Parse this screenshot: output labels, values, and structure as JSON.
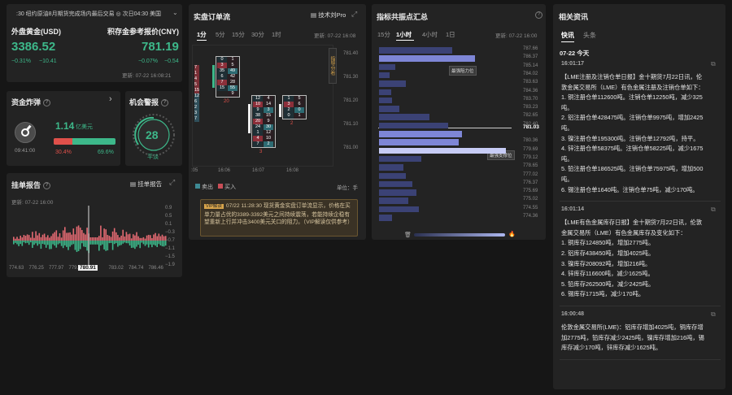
{
  "ticker": {
    "text": ":30 纽约原油8月期货完成场内最后交易 ◎ 次日04:30 美国",
    "arrow": "chevron-down"
  },
  "gold": {
    "left_title": "外盘黄金(USD)",
    "left_price": "3386.52",
    "left_pct": "−0.31%",
    "left_chg": "−10.41",
    "right_title": "积存金参考报价(CNY)",
    "right_price": "781.19",
    "right_pct": "−0.07%",
    "right_chg": "−0.54",
    "updated": "更新:  07-22 16:08:21"
  },
  "funds": {
    "title": "资金炸弹",
    "value": "1.14",
    "unit": "亿美元",
    "time": "09:41:00",
    "left_pct": "30.4%",
    "right_pct": "69.6%",
    "bar_fill": 0.304
  },
  "alert": {
    "title": "机会警报",
    "value": "28",
    "label": "平淡"
  },
  "orders": {
    "title": "挂单报告",
    "btn": "挂单报告",
    "updated": "更新:  07-22 16:00",
    "yticks": [
      "0.9",
      "0.5",
      "0.1",
      "−0.3",
      "−0.7",
      "−1.1",
      "−1.5",
      "−1.9"
    ],
    "xticks": [
      "774.63",
      "776.25",
      "777.97",
      "779.69",
      "781.4",
      "783.02",
      "784.74",
      "786.46"
    ],
    "current": "780.91"
  },
  "flow": {
    "title": "实盘订单流",
    "tool": "技术刘Pro",
    "tabs": [
      "1分",
      "5分",
      "15分",
      "30分",
      "1时"
    ],
    "active": 0,
    "date": "07-22 16:08",
    "prices": [
      "781.40",
      "781.30",
      "781.20",
      "781.10",
      "781.00"
    ],
    "times": [
      ":05",
      "16:06",
      "16:07",
      "16:08"
    ],
    "legend": [
      "卖出",
      "买入"
    ],
    "unit": "单位：手",
    "side_label": "指导分布",
    "vip_badge": "VIP解读",
    "vip_text": "07/22 11:28:30 现货黄金实盘订单流显示，价格在买单力量占优的3389-3392美元之间持续震荡，若能持续企稳有望重新上行并冲击3400美元关口的阻力。（VIP解读仅供参考）",
    "clusters": [
      {
        "top": [
          "0",
          "3",
          "35",
          "6",
          "7",
          "15"
        ],
        "bot": [
          "1",
          "5",
          "49",
          "42",
          "28",
          "55",
          "9"
        ],
        "foot": [
          "20"
        ]
      },
      {
        "top": [
          "12",
          "10",
          "9",
          "38",
          "20",
          "24",
          "1",
          "4",
          "7"
        ],
        "bot": [
          "4",
          "14",
          "3",
          "15",
          "9",
          "30",
          "12",
          "10",
          "2"
        ],
        "foot": [
          "3"
        ]
      },
      {
        "top": [
          "1",
          "3",
          "2",
          "0"
        ],
        "bot": [
          "5",
          "6",
          "0",
          "1"
        ],
        "foot": [
          "2"
        ]
      }
    ],
    "left_cluster": [
      "7",
      "1",
      "4",
      "5",
      "15",
      "12",
      "6",
      "2",
      "3",
      "7"
    ]
  },
  "levels": {
    "title": "指标共振点汇总",
    "tabs": [
      "15分",
      "1小时",
      "4小时",
      "1日"
    ],
    "active": 1,
    "date": "更新:  07-22 16:00",
    "prices": [
      "787.66",
      "786.37",
      "785.14",
      "784.02",
      "783.63",
      "784.36",
      "783.70",
      "783.23",
      "782.65",
      "782.40",
      "781.03",
      "780.36",
      "779.69",
      "779.12",
      "778.65",
      "777.02",
      "776.37",
      "775.69",
      "775.02",
      "774.55",
      "774.36"
    ],
    "current": "781.03",
    "tip1": "最强阻力位",
    "tip2": "最强支撑位",
    "bars": [
      0.55,
      0.72,
      0.12,
      0.08,
      0.2,
      0.09,
      0.1,
      0.15,
      0.38,
      0.52,
      0.62,
      0.6,
      0.95,
      0.32,
      0.18,
      0.2,
      0.25,
      0.28,
      0.22,
      0.3,
      0.1
    ]
  },
  "news": {
    "title": "相关资讯",
    "tabs": [
      "快讯",
      "头条"
    ],
    "active": 0,
    "date": "07-22 今天",
    "items": [
      {
        "time": "16:01:17",
        "lines": [
          "【LME注册及注销仓单日报】金十期货7月22日讯，伦",
          "敦金属交易所（LME）有色金属注册及注销仓单如下：",
          "1. 铜注册仓单112600吨。注销仓单12250吨，减少325",
          "吨。",
          "2. 铝注册仓单428475吨。注销仓单9975吨，增加2425",
          "吨。",
          "3. 镍注册仓单195300吨。注销仓单12792吨，持平。",
          "4. 锌注册仓单58375吨。注销仓单58225吨，减少1675",
          "吨。",
          "5. 铅注册仓单186525吨。注销仓单75975吨，增加500",
          "吨。",
          "6. 锡注册仓单1640吨。注销仓单75吨，减少170吨。"
        ]
      },
      {
        "time": "16:01:14",
        "lines": [
          "【LME有色金属库存日报】金十期货7月22日讯，伦敦",
          "金属交易所（LME）有色金属库存及变化如下：",
          "1. 铜库存124850吨，增加2775吨。",
          "2. 铝库存438450吨，增加4025吨。",
          "3. 镍库存208092吨，增加216吨。",
          "4. 锌库存116600吨，减少1625吨。",
          "5. 铅库存262500吨，减少2425吨。",
          "6. 锡库存1715吨，减少170吨。"
        ]
      },
      {
        "time": "16:00:48",
        "lines": [
          "伦敦金属交易所(LME)：铝库存增加4025吨，铜库存增",
          "加2775吨，铅库存减少2425吨，镍库存增加216吨，锡",
          "库存减少170吨，锌库存减少1625吨。"
        ]
      }
    ]
  }
}
